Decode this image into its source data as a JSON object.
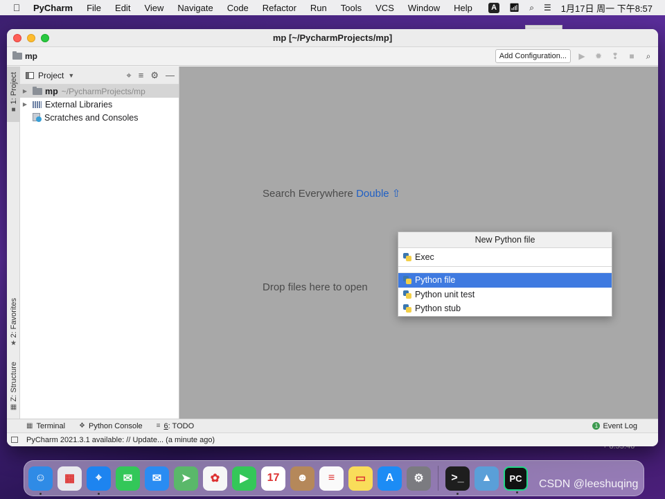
{
  "menubar": {
    "app": "PyCharm",
    "items": [
      "File",
      "Edit",
      "View",
      "Navigate",
      "Code",
      "Refactor",
      "Run",
      "Tools",
      "VCS",
      "Window",
      "Help"
    ],
    "ime": "A",
    "clock": "1月17日 周一 下午8:57"
  },
  "window": {
    "title": "mp [~/PycharmProjects/mp]",
    "breadcrumb": "mp",
    "add_config": "Add Configuration..."
  },
  "stripe": {
    "project": "1: Project",
    "favorites": "2: Favorites",
    "structure": "Z: Structure"
  },
  "project_panel": {
    "title": "Project",
    "tree": [
      {
        "name": "mp",
        "path": "~/PycharmProjects/mp"
      },
      {
        "name": "External Libraries"
      },
      {
        "name": "Scratches and Consoles"
      }
    ]
  },
  "editor": {
    "hint_search": "Search Everywhere",
    "hint_search_key": "Double ⇧",
    "hint_drop": "Drop files here to open"
  },
  "popup": {
    "title": "New Python file",
    "input_value": "Exec",
    "items": [
      "Python file",
      "Python unit test",
      "Python stub"
    ],
    "selected_index": 0
  },
  "bottom_tools": {
    "terminal": "Terminal",
    "python_console": "Python Console",
    "todo_mnemonic": "6",
    "todo_label": ": TODO",
    "event_log": "Event Log"
  },
  "status": {
    "message": "PyCharm 2021.3.1 available: // Update... (a minute ago)"
  },
  "desktop": {
    "time_fragment": "+ 8.55.46",
    "watermark": "CSDN @leeshuqing"
  },
  "dock": {
    "apps": [
      {
        "name": "Finder",
        "color": "#2f8be6",
        "glyph": "☺"
      },
      {
        "name": "Launchpad",
        "color": "#e9e9ee",
        "glyph": "▦"
      },
      {
        "name": "Safari",
        "color": "#1d84f0",
        "glyph": "⌖"
      },
      {
        "name": "Messages",
        "color": "#33c759",
        "glyph": "✉"
      },
      {
        "name": "Mail",
        "color": "#2a8cf2",
        "glyph": "✉"
      },
      {
        "name": "Maps",
        "color": "#5ab86a",
        "glyph": "➤"
      },
      {
        "name": "Photos",
        "color": "#f6f6f6",
        "glyph": "✿"
      },
      {
        "name": "FaceTime",
        "color": "#34c759",
        "glyph": "▶"
      },
      {
        "name": "Calendar",
        "color": "#ffffff",
        "glyph": "17"
      },
      {
        "name": "Contacts",
        "color": "#b5885a",
        "glyph": "☻"
      },
      {
        "name": "Reminders",
        "color": "#fafafa",
        "glyph": "≡"
      },
      {
        "name": "Notes",
        "color": "#f9dd5a",
        "glyph": "▭"
      },
      {
        "name": "App Store",
        "color": "#1c8cf5",
        "glyph": "A"
      },
      {
        "name": "System Preferences",
        "color": "#7b7b80",
        "glyph": "⚙"
      },
      {
        "name": "Terminal",
        "color": "#1e1e1e",
        "glyph": ">_"
      },
      {
        "name": "Preview",
        "color": "#5a9fd8",
        "glyph": "▲"
      },
      {
        "name": "PyCharm",
        "color": "#111111",
        "glyph": "PC"
      }
    ]
  }
}
